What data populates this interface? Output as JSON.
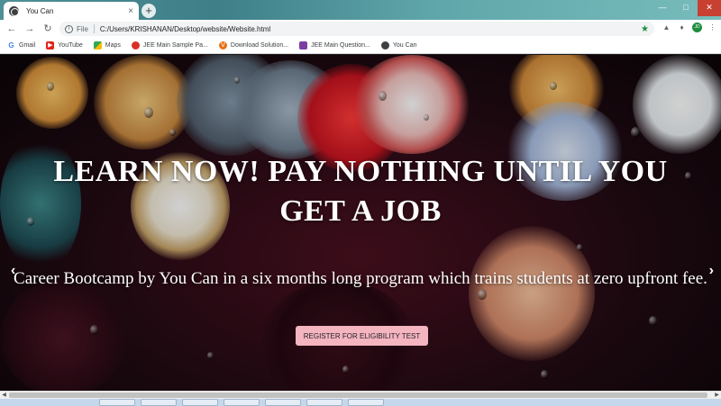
{
  "browser": {
    "tab_title": "You Can",
    "new_tab": "+",
    "tab_close": "×",
    "scheme": "File",
    "url": "C:/Users/KRISHANAN/Desktop/website/Website.html"
  },
  "bookmarks": [
    {
      "label": "Gmail",
      "icon": "google-icon"
    },
    {
      "label": "YouTube",
      "icon": "youtube-icon"
    },
    {
      "label": "Maps",
      "icon": "maps-icon"
    },
    {
      "label": "JEE Main Sample Pa...",
      "icon": "jee-icon"
    },
    {
      "label": "Download Solution...",
      "icon": "download-icon"
    },
    {
      "label": "JEE Main Question...",
      "icon": "question-icon"
    },
    {
      "label": "You Can",
      "icon": "globe-icon"
    }
  ],
  "hero": {
    "title": "LEARN NOW! PAY NOTHING UNTIL YOU GET A JOB",
    "subtitle": "Career Bootcamp by You Can in a six months long program which trains students at zero upfront fee.",
    "cta": "REGISTER FOR ELIGIBILITY TEST",
    "prev": "‹",
    "next": "›"
  },
  "colors": {
    "cta_bg": "#f4b4c0",
    "hero_text": "#ffffff"
  }
}
